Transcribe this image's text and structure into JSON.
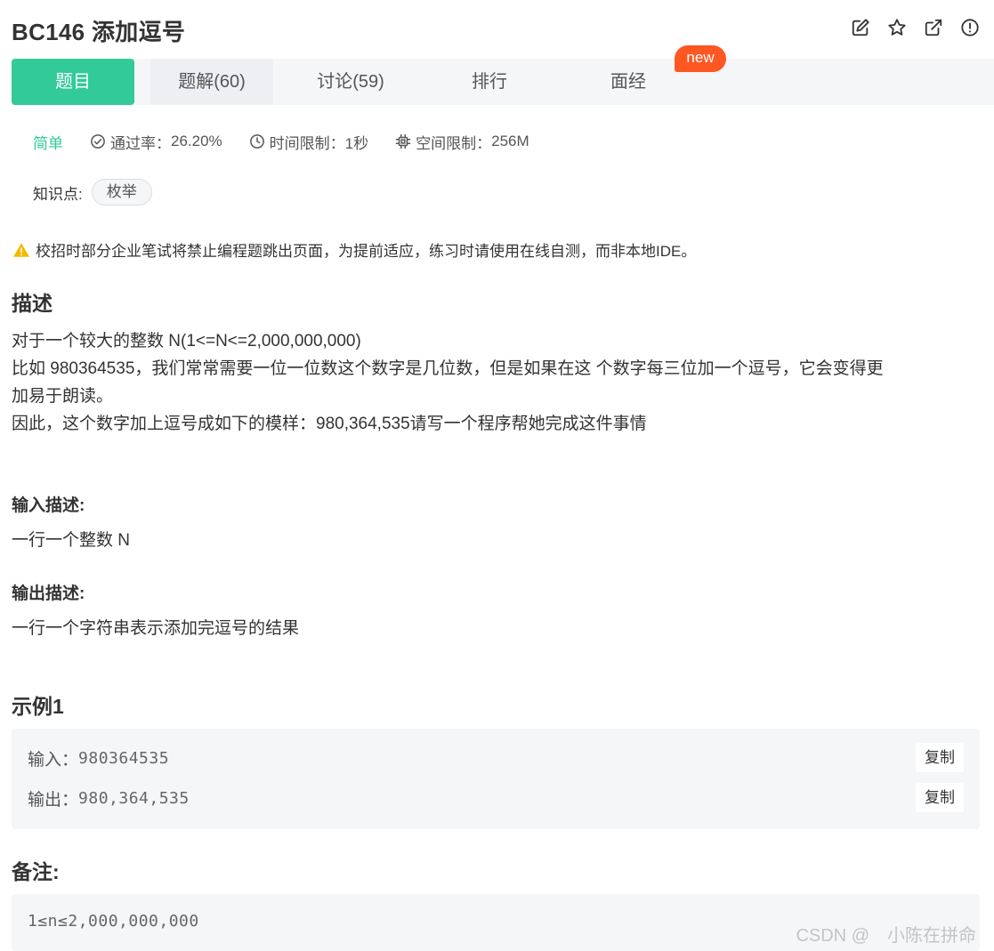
{
  "problem": {
    "id": "BC146",
    "name": "添加逗号"
  },
  "actions": [
    {
      "name": "edit-icon"
    },
    {
      "name": "star-icon"
    },
    {
      "name": "share-icon"
    },
    {
      "name": "report-icon"
    }
  ],
  "tabs": [
    {
      "label": "题目",
      "active": true
    },
    {
      "label": "题解(60)"
    },
    {
      "label": "讨论(59)"
    },
    {
      "label": "排行"
    },
    {
      "label": "面经"
    }
  ],
  "new_badge": "new",
  "meta": {
    "level": "简单",
    "pass_rate_label": "通过率：",
    "pass_rate": "26.20%",
    "time_limit_label": "时间限制：",
    "time_limit": "1秒",
    "memory_limit_label": "空间限制：",
    "memory_limit": "256M"
  },
  "knowledge": {
    "label": "知识点:",
    "tags": [
      "枚举"
    ]
  },
  "notice": "校招时部分企业笔试将禁止编程题跳出页面，为提前适应，练习时请使用在线自测，而非本地IDE。",
  "description": {
    "heading": "描述",
    "lines": [
      "对于一个较大的整数 N(1<=N<=2,000,000,000)",
      "比如 980364535，我们常常需要一位一位数这个数字是几位数，但是如果在这 个数字每三位加一个逗号，它会变得更",
      "加易于朗读。",
      "因此，这个数字加上逗号成如下的模样：980,364,535请写一个程序帮她完成这件事情"
    ]
  },
  "input_desc": {
    "heading": "输入描述:",
    "text": "一行一个整数 N"
  },
  "output_desc": {
    "heading": "输出描述:",
    "text": "一行一个字符串表示添加完逗号的结果"
  },
  "example": {
    "heading": "示例1",
    "input_label": "输入：",
    "input_value": "980364535",
    "output_label": "输出：",
    "output_value": "980,364,535",
    "copy_label": "复制"
  },
  "notes": {
    "heading": "备注:",
    "text": "1≤n≤2,000,000,000"
  },
  "watermark": "CSDN @　小陈在拼命",
  "colors": {
    "accent": "#32ca99",
    "badge": "#ff5722",
    "warning": "#f5b800"
  }
}
